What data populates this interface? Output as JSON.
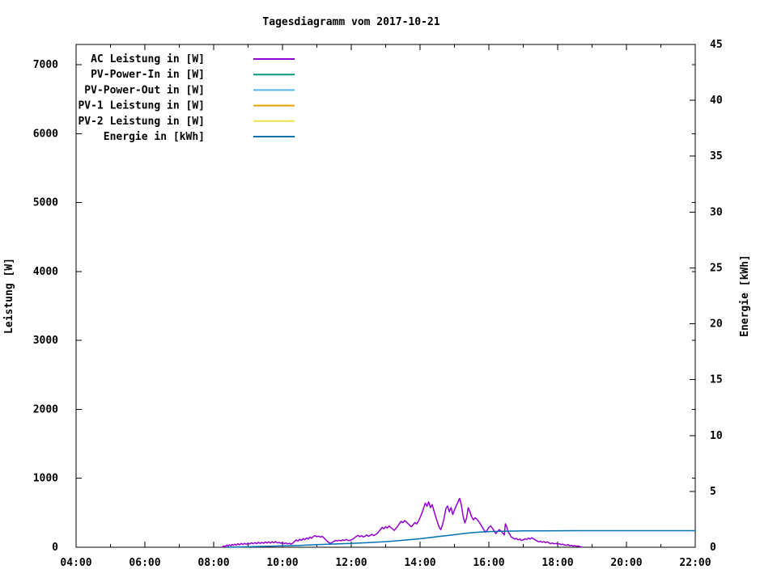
{
  "chart_data": {
    "type": "line",
    "title": "Tagesdiagramm vom 2017-10-21",
    "grid": false,
    "legend_position": "top-left-inside",
    "x_axis": {
      "range_hours": [
        4,
        22
      ],
      "major_tick_hours": [
        4,
        6,
        8,
        10,
        12,
        14,
        16,
        18,
        20,
        22
      ],
      "major_tick_labels": [
        "04:00",
        "06:00",
        "08:00",
        "10:00",
        "12:00",
        "14:00",
        "16:00",
        "18:00",
        "20:00",
        "22:00"
      ],
      "minor_tick_hours": [
        5,
        7,
        9,
        11,
        13,
        15,
        17,
        19,
        21
      ]
    },
    "y_axis": {
      "label": "Leistung [W]",
      "range": [
        0,
        7293
      ],
      "tick_values": [
        0,
        1000,
        2000,
        3000,
        4000,
        5000,
        6000,
        7000
      ],
      "tick_labels": [
        "0",
        "1000",
        "2000",
        "3000",
        "4000",
        "5000",
        "6000",
        "7000"
      ]
    },
    "y2_axis": {
      "label": "Energie [kWh]",
      "range": [
        0,
        45
      ],
      "tick_values": [
        0,
        5,
        10,
        15,
        20,
        25,
        30,
        35,
        40,
        45
      ],
      "tick_labels": [
        "0",
        "5",
        "10",
        "15",
        "20",
        "25",
        "30",
        "35",
        "40",
        "45"
      ]
    },
    "series": [
      {
        "id": "ac-leistung",
        "name": "AC Leistung in [W]",
        "color": "#9400d3",
        "axis": "y1",
        "points": [
          [
            8.25,
            3
          ],
          [
            8.3,
            20
          ],
          [
            8.33,
            8
          ],
          [
            8.38,
            30
          ],
          [
            8.42,
            15
          ],
          [
            8.46,
            35
          ],
          [
            8.5,
            22
          ],
          [
            8.54,
            40
          ],
          [
            8.58,
            28
          ],
          [
            8.62,
            45
          ],
          [
            8.66,
            30
          ],
          [
            8.7,
            50
          ],
          [
            8.75,
            35
          ],
          [
            8.8,
            55
          ],
          [
            8.85,
            40
          ],
          [
            8.9,
            58
          ],
          [
            8.95,
            42
          ],
          [
            9,
            60
          ],
          [
            9.05,
            48
          ],
          [
            9.1,
            65
          ],
          [
            9.15,
            50
          ],
          [
            9.2,
            68
          ],
          [
            9.25,
            52
          ],
          [
            9.3,
            72
          ],
          [
            9.35,
            55
          ],
          [
            9.4,
            70
          ],
          [
            9.45,
            58
          ],
          [
            9.5,
            75
          ],
          [
            9.55,
            62
          ],
          [
            9.6,
            78
          ],
          [
            9.65,
            60
          ],
          [
            9.7,
            80
          ],
          [
            9.75,
            65
          ],
          [
            9.8,
            82
          ],
          [
            9.85,
            62
          ],
          [
            9.9,
            72
          ],
          [
            9.95,
            58
          ],
          [
            10,
            68
          ],
          [
            10.05,
            52
          ],
          [
            10.1,
            62
          ],
          [
            10.15,
            48
          ],
          [
            10.2,
            58
          ],
          [
            10.25,
            44
          ],
          [
            10.3,
            60
          ],
          [
            10.35,
            85
          ],
          [
            10.4,
            105
          ],
          [
            10.45,
            90
          ],
          [
            10.5,
            115
          ],
          [
            10.55,
            100
          ],
          [
            10.6,
            125
          ],
          [
            10.65,
            110
          ],
          [
            10.7,
            135
          ],
          [
            10.75,
            120
          ],
          [
            10.8,
            148
          ],
          [
            10.85,
            130
          ],
          [
            10.9,
            158
          ],
          [
            10.95,
            168
          ],
          [
            11,
            152
          ],
          [
            11.05,
            162
          ],
          [
            11.1,
            148
          ],
          [
            11.15,
            158
          ],
          [
            11.2,
            138
          ],
          [
            11.25,
            112
          ],
          [
            11.3,
            88
          ],
          [
            11.35,
            68
          ],
          [
            11.4,
            55
          ],
          [
            11.45,
            72
          ],
          [
            11.5,
            88
          ],
          [
            11.55,
            98
          ],
          [
            11.6,
            92
          ],
          [
            11.65,
            102
          ],
          [
            11.7,
            94
          ],
          [
            11.75,
            108
          ],
          [
            11.8,
            98
          ],
          [
            11.85,
            112
          ],
          [
            11.9,
            102
          ],
          [
            11.95,
            96
          ],
          [
            12,
            108
          ],
          [
            12.05,
            118
          ],
          [
            12.1,
            138
          ],
          [
            12.15,
            158
          ],
          [
            12.2,
            172
          ],
          [
            12.25,
            152
          ],
          [
            12.3,
            168
          ],
          [
            12.35,
            148
          ],
          [
            12.4,
            162
          ],
          [
            12.45,
            178
          ],
          [
            12.5,
            158
          ],
          [
            12.55,
            172
          ],
          [
            12.6,
            188
          ],
          [
            12.65,
            168
          ],
          [
            12.7,
            182
          ],
          [
            12.75,
            198
          ],
          [
            12.8,
            228
          ],
          [
            12.85,
            258
          ],
          [
            12.9,
            288
          ],
          [
            12.95,
            268
          ],
          [
            13,
            298
          ],
          [
            13.05,
            278
          ],
          [
            13.1,
            308
          ],
          [
            13.15,
            285
          ],
          [
            13.2,
            265
          ],
          [
            13.25,
            245
          ],
          [
            13.3,
            275
          ],
          [
            13.35,
            305
          ],
          [
            13.4,
            345
          ],
          [
            13.45,
            375
          ],
          [
            13.5,
            355
          ],
          [
            13.55,
            388
          ],
          [
            13.6,
            368
          ],
          [
            13.65,
            342
          ],
          [
            13.7,
            318
          ],
          [
            13.75,
            298
          ],
          [
            13.8,
            328
          ],
          [
            13.85,
            358
          ],
          [
            13.9,
            338
          ],
          [
            13.95,
            378
          ],
          [
            14,
            430
          ],
          [
            14.05,
            490
          ],
          [
            14.1,
            565
          ],
          [
            14.15,
            640
          ],
          [
            14.2,
            595
          ],
          [
            14.25,
            658
          ],
          [
            14.3,
            575
          ],
          [
            14.35,
            618
          ],
          [
            14.4,
            535
          ],
          [
            14.45,
            450
          ],
          [
            14.5,
            370
          ],
          [
            14.55,
            295
          ],
          [
            14.6,
            255
          ],
          [
            14.65,
            320
          ],
          [
            14.7,
            430
          ],
          [
            14.75,
            560
          ],
          [
            14.8,
            598
          ],
          [
            14.85,
            515
          ],
          [
            14.9,
            575
          ],
          [
            14.95,
            475
          ],
          [
            15,
            540
          ],
          [
            15.05,
            600
          ],
          [
            15.1,
            655
          ],
          [
            15.15,
            708
          ],
          [
            15.2,
            615
          ],
          [
            15.25,
            455
          ],
          [
            15.3,
            352
          ],
          [
            15.35,
            420
          ],
          [
            15.4,
            575
          ],
          [
            15.45,
            515
          ],
          [
            15.5,
            438
          ],
          [
            15.55,
            398
          ],
          [
            15.6,
            428
          ],
          [
            15.65,
            408
          ],
          [
            15.7,
            378
          ],
          [
            15.75,
            338
          ],
          [
            15.8,
            298
          ],
          [
            15.85,
            258
          ],
          [
            15.9,
            218
          ],
          [
            15.95,
            248
          ],
          [
            16,
            288
          ],
          [
            16.05,
            308
          ],
          [
            16.1,
            278
          ],
          [
            16.15,
            238
          ],
          [
            16.2,
            198
          ],
          [
            16.25,
            228
          ],
          [
            16.3,
            255
          ],
          [
            16.35,
            238
          ],
          [
            16.4,
            208
          ],
          [
            16.45,
            178
          ],
          [
            16.48,
            340
          ],
          [
            16.52,
            298
          ],
          [
            16.56,
            220
          ],
          [
            16.6,
            195
          ],
          [
            16.65,
            150
          ],
          [
            16.7,
            135
          ],
          [
            16.75,
            118
          ],
          [
            16.8,
            128
          ],
          [
            16.85,
            108
          ],
          [
            16.9,
            118
          ],
          [
            16.95,
            98
          ],
          [
            17,
            108
          ],
          [
            17.05,
            122
          ],
          [
            17.1,
            112
          ],
          [
            17.15,
            132
          ],
          [
            17.2,
            118
          ],
          [
            17.25,
            138
          ],
          [
            17.3,
            122
          ],
          [
            17.35,
            105
          ],
          [
            17.4,
            92
          ],
          [
            17.45,
            78
          ],
          [
            17.5,
            88
          ],
          [
            17.55,
            72
          ],
          [
            17.6,
            82
          ],
          [
            17.65,
            68
          ],
          [
            17.7,
            78
          ],
          [
            17.75,
            62
          ],
          [
            17.8,
            52
          ],
          [
            17.85,
            62
          ],
          [
            17.9,
            48
          ],
          [
            17.95,
            58
          ],
          [
            18,
            42
          ],
          [
            18.05,
            52
          ],
          [
            18.1,
            38
          ],
          [
            18.15,
            46
          ],
          [
            18.2,
            32
          ],
          [
            18.25,
            28
          ],
          [
            18.3,
            38
          ],
          [
            18.35,
            22
          ],
          [
            18.4,
            28
          ],
          [
            18.45,
            18
          ],
          [
            18.5,
            24
          ],
          [
            18.55,
            12
          ],
          [
            18.6,
            18
          ],
          [
            18.65,
            8
          ],
          [
            18.7,
            4
          ]
        ]
      },
      {
        "id": "pv-power-in",
        "name": "PV-Power-In in [W]",
        "color": "#009e73",
        "axis": "y1",
        "points": []
      },
      {
        "id": "pv-power-out",
        "name": "PV-Power-Out in [W]",
        "color": "#56b4e9",
        "axis": "y1",
        "points": []
      },
      {
        "id": "pv-1-leistung",
        "name": "PV-1 Leistung in [W]",
        "color": "#e69f00",
        "axis": "y1",
        "points": []
      },
      {
        "id": "pv-2-leistung",
        "name": "PV-2 Leistung in [W]",
        "color": "#f0e442",
        "axis": "y1",
        "points": []
      },
      {
        "id": "energie",
        "name": "Energie in [kWh]",
        "color": "#0072b2",
        "axis": "y2",
        "points": [
          [
            8.4,
            0
          ],
          [
            9,
            0.04
          ],
          [
            9.5,
            0.08
          ],
          [
            10,
            0.12
          ],
          [
            10.5,
            0.17
          ],
          [
            11,
            0.24
          ],
          [
            11.5,
            0.29
          ],
          [
            12,
            0.34
          ],
          [
            12.5,
            0.41
          ],
          [
            13,
            0.5
          ],
          [
            13.5,
            0.62
          ],
          [
            14,
            0.76
          ],
          [
            14.25,
            0.85
          ],
          [
            14.5,
            0.95
          ],
          [
            14.75,
            1.03
          ],
          [
            15,
            1.12
          ],
          [
            15.25,
            1.22
          ],
          [
            15.5,
            1.3
          ],
          [
            15.75,
            1.36
          ],
          [
            16,
            1.4
          ],
          [
            16.25,
            1.42
          ],
          [
            16.5,
            1.44
          ],
          [
            16.75,
            1.45
          ],
          [
            17,
            1.46
          ],
          [
            17.5,
            1.47
          ],
          [
            18,
            1.475
          ],
          [
            18.5,
            1.48
          ],
          [
            19,
            1.48
          ],
          [
            20,
            1.48
          ],
          [
            21,
            1.48
          ],
          [
            22,
            1.48
          ]
        ]
      }
    ]
  }
}
